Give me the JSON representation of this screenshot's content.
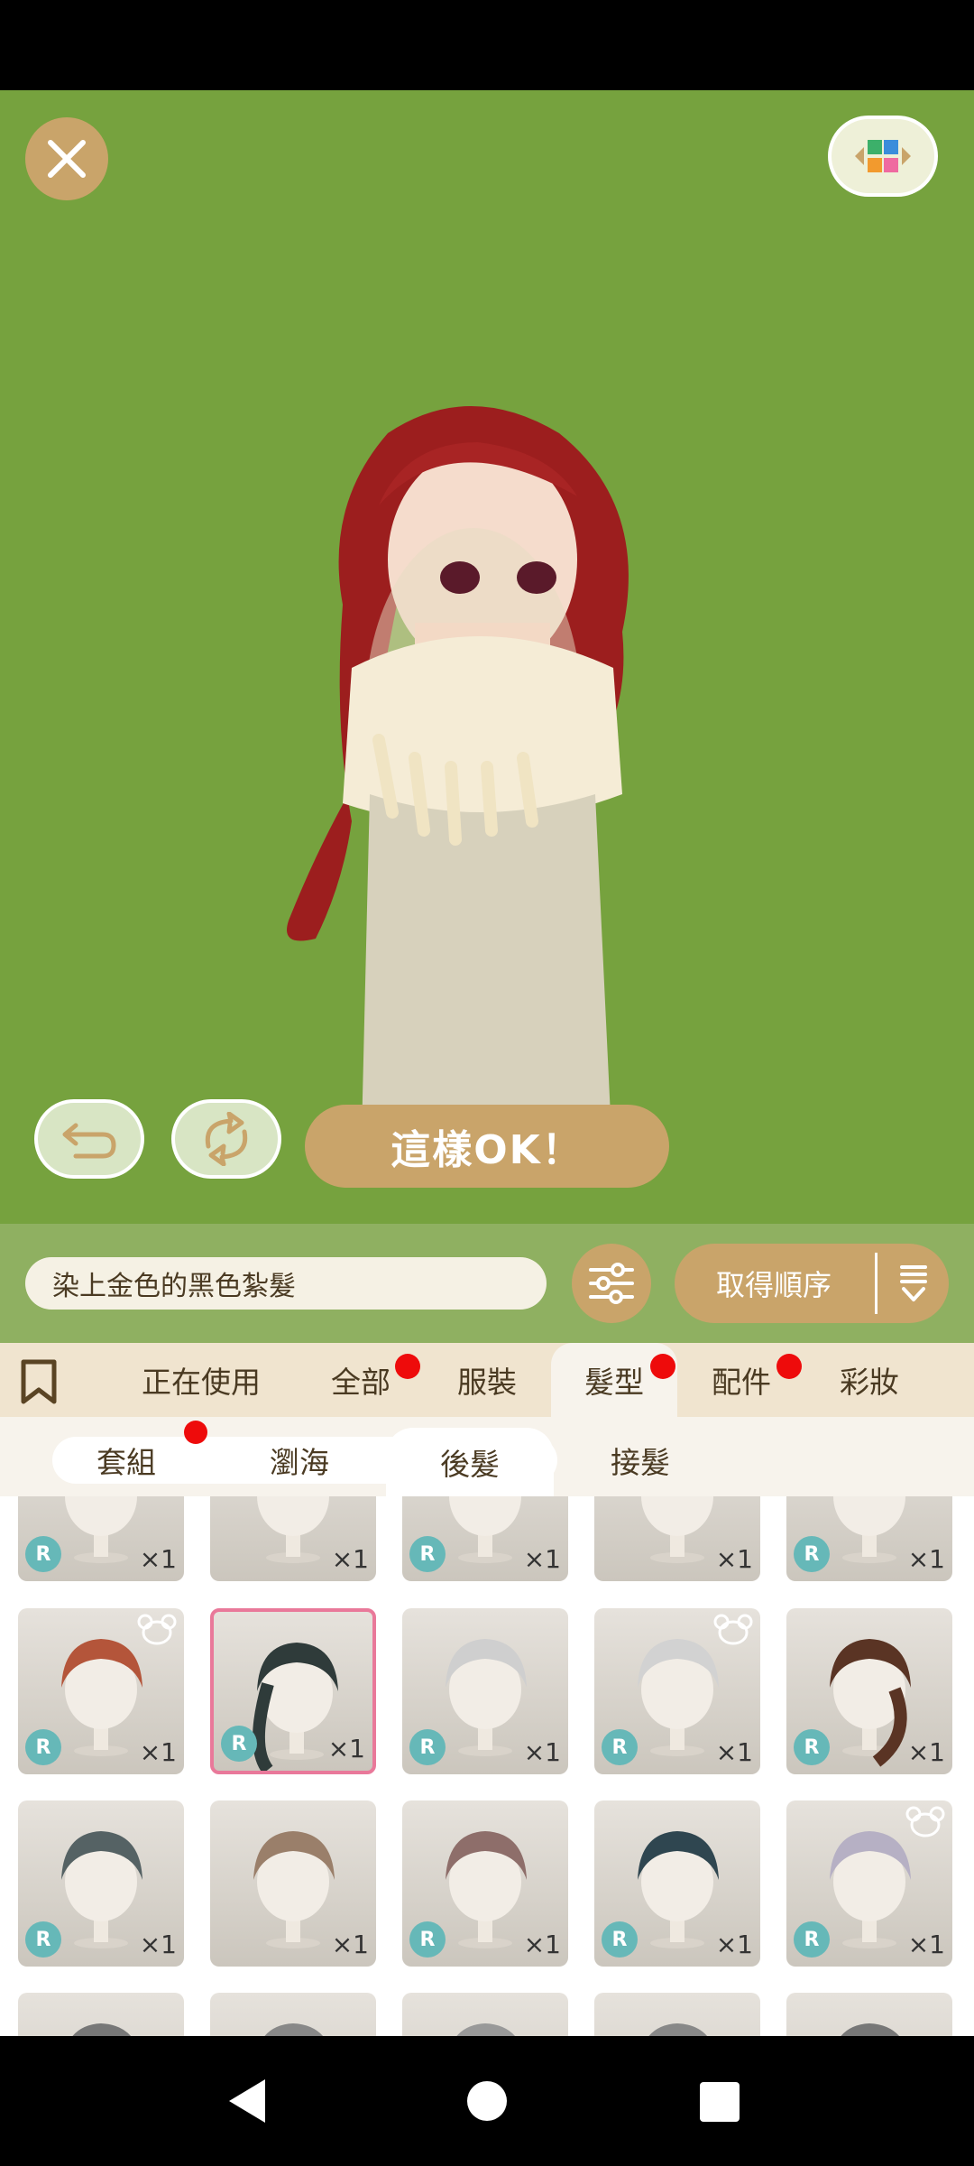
{
  "stage": {
    "ok_label": "這樣OK！"
  },
  "toolbar": {
    "item_name": "染上金色的黑色紮髮",
    "order_label": "取得順序"
  },
  "category_tabs": [
    {
      "label": "正在使用",
      "dot": false,
      "active": false
    },
    {
      "label": "全部",
      "dot": true,
      "active": false
    },
    {
      "label": "服裝",
      "dot": false,
      "active": false
    },
    {
      "label": "髮型",
      "dot": true,
      "active": true
    },
    {
      "label": "配件",
      "dot": true,
      "active": false
    },
    {
      "label": "彩妝",
      "dot": false,
      "active": false
    }
  ],
  "sub_tabs": [
    {
      "label": "套組",
      "dot": true,
      "active": false
    },
    {
      "label": "瀏海",
      "dot": false,
      "active": false
    },
    {
      "label": "後髮",
      "dot": false,
      "active": true
    },
    {
      "label": "接髮",
      "dot": false,
      "active": false
    }
  ],
  "items": {
    "badge": "R",
    "quantity": "×1"
  },
  "colors": {
    "stage_bg": "#76a23e",
    "gold": "#c9a46a",
    "notification_dot": "#ee0b0b",
    "selected_border": "#e9799a",
    "rarity_badge": "#66b8b8"
  },
  "icons": [
    "close-icon",
    "palette-icon",
    "undo-icon",
    "rotate-icon",
    "filter-sliders-icon",
    "sort-icon",
    "bookmark-icon",
    "bear-icon",
    "nav-back-icon",
    "nav-home-icon",
    "nav-recents-icon"
  ]
}
